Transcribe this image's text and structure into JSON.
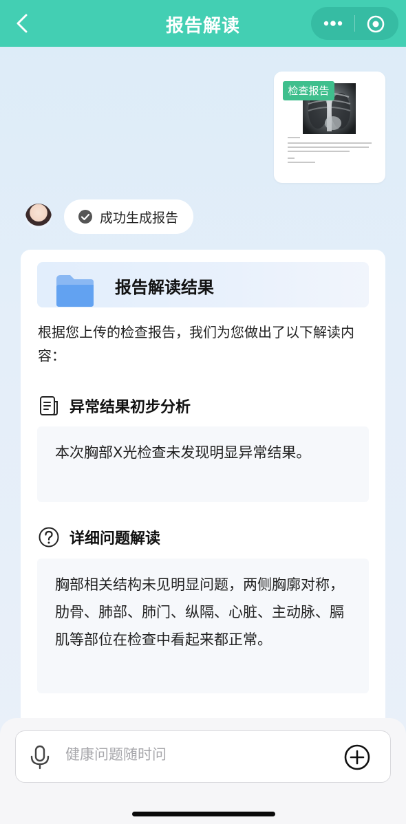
{
  "header": {
    "title": "报告解读",
    "back_icon": "chevron-left-icon",
    "more_icon": "more-dots-icon",
    "close_icon": "target-circle-icon",
    "bg_color": "#43cfb3"
  },
  "user_message": {
    "tag": "检查报告",
    "tag_color": "#3fbf8d"
  },
  "bot_status": {
    "text": "成功生成报告",
    "icon": "check-circle-icon"
  },
  "result": {
    "title": "报告解读结果",
    "intro": "根据您上传的检查报告，我们为您做出了以下解读内容：",
    "sections": [
      {
        "icon": "document-icon",
        "heading": "异常结果初步分析",
        "body": "本次胸部X光检查未发现明显异常结果。"
      },
      {
        "icon": "question-circle-icon",
        "heading": "详细问题解读",
        "body": "胸部相关结构未见明显问题，两侧胸廓对称，肋骨、肺部、肺门、纵隔、心脏、主动脉、膈肌等部位在检查中看起来都正常。"
      }
    ]
  },
  "input": {
    "placeholder": "健康问题随时问",
    "value": "",
    "mic_icon": "microphone-icon",
    "plus_icon": "plus-circle-icon"
  }
}
